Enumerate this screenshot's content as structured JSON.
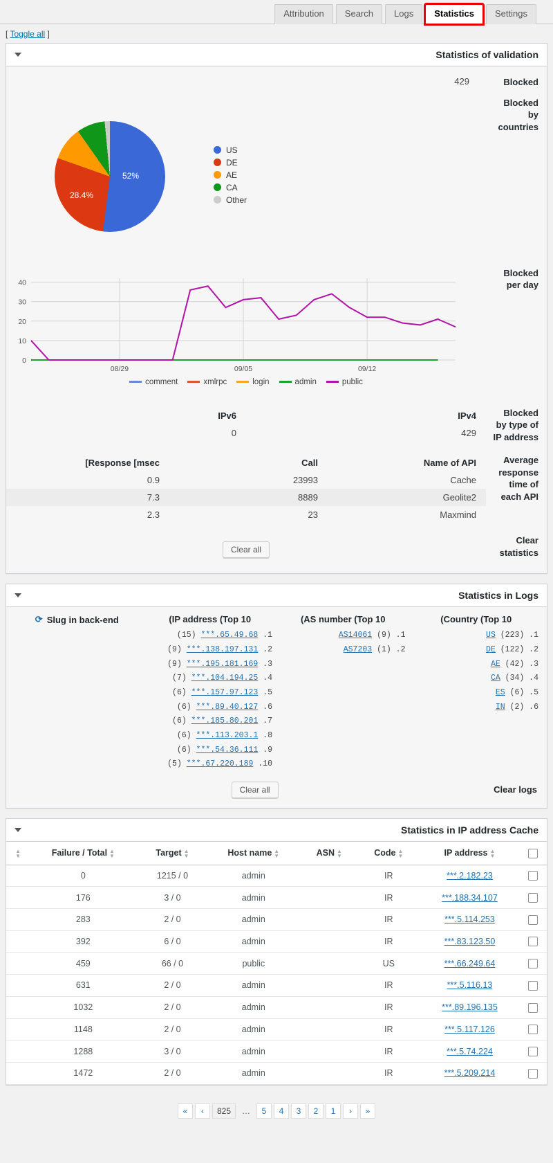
{
  "tabs": [
    {
      "label": "Attribution",
      "active": false
    },
    {
      "label": "Search",
      "active": false
    },
    {
      "label": "Logs",
      "active": false
    },
    {
      "label": "Statistics",
      "active": true
    },
    {
      "label": "Settings",
      "active": false
    }
  ],
  "toggle_all": "[ Toggle all ]",
  "validation": {
    "title": "Statistics of validation",
    "blocked_label": "Blocked",
    "blocked_value": "429",
    "blocked_by_countries_label": "Blocked by countries",
    "blocked_per_day_label": "Blocked per day",
    "blocked_by_type_label": "Blocked by type of IP address",
    "ip_type": {
      "headers": [
        "[Response [msec",
        "Call",
        "Name of API"
      ],
      "ipv6_header": "IPv6",
      "ipv4_header": "IPv4",
      "ipv6_value": "0",
      "ipv4_value": "429"
    },
    "avg_response_label": "Average response time of each API",
    "api_table": {
      "headers": [
        "[Response [msec",
        "Call",
        "Name of API"
      ],
      "rows": [
        {
          "response": "0.9",
          "call": "23993",
          "name": "Cache"
        },
        {
          "response": "7.3",
          "call": "8889",
          "name": "Geolite2"
        },
        {
          "response": "2.3",
          "call": "23",
          "name": "Maxmind"
        }
      ]
    },
    "clear_statistics_label": "Clear statistics",
    "clear_all_button": "Clear all"
  },
  "chart_data": [
    {
      "type": "pie",
      "title": "Blocked by countries",
      "labels": [
        "US",
        "DE",
        "AE",
        "CA",
        "Other"
      ],
      "values": [
        52,
        28.4,
        9.8,
        8.3,
        1.5
      ],
      "display_labels": [
        "52%",
        "28.4%",
        "",
        "",
        ""
      ],
      "colors": [
        "#3a68d6",
        "#dc3912",
        "#ff9900",
        "#109618",
        "#cccccc"
      ],
      "legend_position": "right"
    },
    {
      "type": "line",
      "title": "Blocked per day",
      "xlabel": "",
      "ylabel": "",
      "ylim": [
        0,
        42
      ],
      "yticks": [
        0,
        10,
        20,
        30,
        40
      ],
      "grid": true,
      "xtick_labels": [
        "08/29",
        "09/05",
        "09/12"
      ],
      "xtick_positions": [
        5,
        12,
        19
      ],
      "legend_position": "bottom",
      "series": [
        {
          "name": "comment",
          "color": "#6389d8",
          "values": [
            0,
            0,
            0,
            0,
            0,
            0,
            0,
            0,
            0,
            0,
            0,
            0,
            0,
            0,
            0,
            0,
            0,
            0,
            0,
            0,
            0,
            0,
            0,
            0
          ]
        },
        {
          "name": "xmlrpc",
          "color": "#e0552f",
          "values": [
            0,
            0,
            0,
            0,
            0,
            0,
            0,
            0,
            0,
            0,
            0,
            0,
            0,
            0,
            0,
            0,
            0,
            0,
            0,
            0,
            0,
            0,
            0,
            0
          ]
        },
        {
          "name": "login",
          "color": "#f5a623",
          "values": [
            0,
            0,
            0,
            0,
            0,
            0,
            0,
            0,
            0,
            0,
            0,
            0,
            0,
            0,
            0,
            0,
            0,
            0,
            0,
            0,
            0,
            0,
            0,
            0
          ]
        },
        {
          "name": "admin",
          "color": "#1aa22e",
          "values": [
            0,
            0,
            0,
            0,
            0,
            0,
            0,
            0,
            0,
            0,
            0,
            0,
            0,
            0,
            0,
            0,
            0,
            0,
            0,
            0,
            0,
            0,
            0,
            0
          ]
        },
        {
          "name": "public",
          "color": "#b213a8",
          "values": [
            10,
            0,
            0,
            0,
            0,
            0,
            0,
            0,
            0,
            36,
            38,
            27,
            31,
            32,
            21,
            23,
            31,
            34,
            27,
            22,
            22,
            19,
            18,
            21,
            17
          ]
        }
      ]
    }
  ],
  "logs": {
    "title": "Statistics in Logs",
    "slug_header": "Slug in back-end",
    "ip_header": "(IP address (Top 10",
    "as_header": "(AS number (Top 10",
    "country_header": "(Country (Top 10",
    "ip_entries": [
      {
        "rank": "1.",
        "value": "65.49.68.***",
        "count": "(15)"
      },
      {
        "rank": "2.",
        "value": "138.197.131.***",
        "count": "(9)"
      },
      {
        "rank": "3.",
        "value": "195.181.169.***",
        "count": "(9)"
      },
      {
        "rank": "4.",
        "value": "104.194.25.***",
        "count": "(7)"
      },
      {
        "rank": "5.",
        "value": "157.97.123.***",
        "count": "(6)"
      },
      {
        "rank": "6.",
        "value": "89.40.127.***",
        "count": "(6)"
      },
      {
        "rank": "7.",
        "value": "185.80.201.***",
        "count": "(6)"
      },
      {
        "rank": "8.",
        "value": "113.203.1.***",
        "count": "(6)"
      },
      {
        "rank": "9.",
        "value": "54.36.111.***",
        "count": "(6)"
      },
      {
        "rank": "10.",
        "value": "67.220.189.***",
        "count": "(5)"
      }
    ],
    "as_entries": [
      {
        "rank": "1.",
        "value": "AS14061",
        "count": "(9)"
      },
      {
        "rank": "2.",
        "value": "AS7203",
        "count": "(1)"
      }
    ],
    "country_entries": [
      {
        "rank": "1.",
        "value": "US",
        "count": "(223)"
      },
      {
        "rank": "2.",
        "value": "DE",
        "count": "(122)"
      },
      {
        "rank": "3.",
        "value": "AE",
        "count": "(42)"
      },
      {
        "rank": "4.",
        "value": "CA",
        "count": "(34)"
      },
      {
        "rank": "5.",
        "value": "ES",
        "count": "(6)"
      },
      {
        "rank": "6.",
        "value": "IN",
        "count": "(2)"
      }
    ],
    "clear_logs_label": "Clear logs",
    "clear_all_button": "Clear all"
  },
  "cache": {
    "title": "Statistics in IP address Cache",
    "headers": [
      "Failure / Total",
      "Target",
      "Host name",
      "ASN",
      "Code",
      "IP address"
    ],
    "rows": [
      {
        "failure": "0",
        "target": "1215 / 0",
        "host": "admin",
        "asn": "",
        "code": "IR",
        "ip": "***.2.182.23"
      },
      {
        "failure": "176",
        "target": "3 / 0",
        "host": "admin",
        "asn": "",
        "code": "IR",
        "ip": "***.188.34.107"
      },
      {
        "failure": "283",
        "target": "2 / 0",
        "host": "admin",
        "asn": "",
        "code": "IR",
        "ip": "***.5.114.253"
      },
      {
        "failure": "392",
        "target": "6 / 0",
        "host": "admin",
        "asn": "",
        "code": "IR",
        "ip": "***.83.123.50"
      },
      {
        "failure": "459",
        "target": "66 / 0",
        "host": "public",
        "asn": "",
        "code": "US",
        "ip": "***.66.249.64"
      },
      {
        "failure": "631",
        "target": "2 / 0",
        "host": "admin",
        "asn": "",
        "code": "IR",
        "ip": "***.5.116.13"
      },
      {
        "failure": "1032",
        "target": "2 / 0",
        "host": "admin",
        "asn": "",
        "code": "IR",
        "ip": "***.89.196.135"
      },
      {
        "failure": "1148",
        "target": "2 / 0",
        "host": "admin",
        "asn": "",
        "code": "IR",
        "ip": "***.5.117.126"
      },
      {
        "failure": "1288",
        "target": "3 / 0",
        "host": "admin",
        "asn": "",
        "code": "IR",
        "ip": "***.5.74.224"
      },
      {
        "failure": "1472",
        "target": "2 / 0",
        "host": "admin",
        "asn": "",
        "code": "IR",
        "ip": "***.5.209.214"
      }
    ]
  },
  "pagination": {
    "first": "«",
    "prev": "‹",
    "total": "825",
    "dots": "…",
    "pages": [
      "5",
      "4",
      "3",
      "2",
      "1"
    ],
    "next": "›",
    "last": "»",
    "current": "1"
  },
  "colors": {
    "accent": "#2271b1",
    "highlight": "#e60000"
  }
}
